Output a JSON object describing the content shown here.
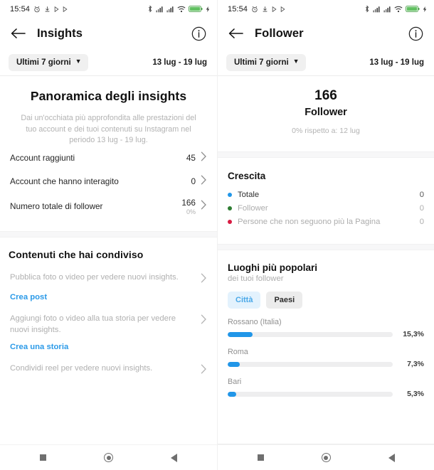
{
  "status_bar": {
    "time": "15:54",
    "left_icons": [
      "alarm-icon",
      "download-icon",
      "play-icon",
      "play-icon"
    ],
    "right_icons": [
      "bluetooth-icon",
      "signal-icon",
      "signal-icon",
      "wifi-icon",
      "battery-icon",
      "charging-icon"
    ],
    "battery_level": "99"
  },
  "colors": {
    "accent_blue": "#2196e8",
    "link_blue": "#2b9ae8",
    "chip_active_bg": "#e3f2fd",
    "chip_inactive_bg": "#ececec",
    "growth_total": "#2196e8",
    "growth_follower": "#2e7d32",
    "growth_unfollow": "#d81b42",
    "track_gray": "#eeeeef"
  },
  "left": {
    "appbar": {
      "title": "Insights",
      "back_icon": "arrow-left-icon",
      "info_icon": "info-circle-icon"
    },
    "filter": {
      "range_label": "Ultimi 7 giorni",
      "caret_icon": "chevron-down-icon",
      "date_range": "13 lug - 19 lug"
    },
    "overview": {
      "title": "Panoramica degli insights",
      "description": "Dai un'occhiata più approfondita alle prestazioni del tuo account e dei tuoi contenuti su Instagram nel periodo 13 lug - 19 lug."
    },
    "metrics": [
      {
        "label": "Account raggiunti",
        "value": "45",
        "sub": ""
      },
      {
        "label": "Account che hanno interagito",
        "value": "0",
        "sub": ""
      },
      {
        "label": "Numero totale di follower",
        "value": "166",
        "sub": "0%"
      }
    ],
    "content_section": {
      "title": "Contenuti che hai condiviso",
      "items": [
        {
          "text": "Pubblica foto o video per vedere nuovi insights.",
          "cta": "Crea post"
        },
        {
          "text": "Aggiungi foto o video alla tua storia per vedere nuovi insights.",
          "cta": "Crea una storia"
        },
        {
          "text": "Condividi reel per vedere nuovi insights.",
          "cta": ""
        }
      ]
    }
  },
  "right": {
    "appbar": {
      "title": "Follower",
      "back_icon": "arrow-left-icon",
      "info_icon": "info-circle-icon"
    },
    "filter": {
      "range_label": "Ultimi 7 giorni",
      "caret_icon": "chevron-down-icon",
      "date_range": "13 lug - 19 lug"
    },
    "kpi": {
      "number": "166",
      "label": "Follower",
      "comparison": "0% rispetto a: 12 lug"
    },
    "growth": {
      "title": "Crescita",
      "items": [
        {
          "name": "Totale",
          "value": "0",
          "color": "#2196e8"
        },
        {
          "name": "Follower",
          "value": "0",
          "color": "#2e7d32"
        },
        {
          "name": "Persone che non seguono più la Pagina",
          "value": "0",
          "color": "#d81b42"
        }
      ]
    },
    "places": {
      "title": "Luoghi più popolari",
      "subtitle": "dei tuoi follower",
      "tabs": [
        {
          "label": "Città",
          "active": true
        },
        {
          "label": "Paesi",
          "active": false
        }
      ]
    }
  },
  "chart_data": {
    "type": "bar",
    "title": "Luoghi più popolari",
    "subtitle": "dei tuoi follower",
    "orientation": "horizontal",
    "categories": [
      "Rossano (Italia)",
      "Roma",
      "Bari"
    ],
    "values": [
      15.3,
      7.3,
      5.3
    ],
    "value_labels": [
      "15,3%",
      "7,3%",
      "5,3%"
    ],
    "xlabel": "",
    "ylabel": "",
    "xlim": [
      0,
      100
    ],
    "unit": "%",
    "grid": false,
    "legend": false,
    "series_color": "#2196e8",
    "track_color": "#eeeeef"
  },
  "navbar": {
    "buttons": [
      {
        "icon": "recents-square-icon"
      },
      {
        "icon": "home-circle-icon"
      },
      {
        "icon": "back-triangle-icon"
      }
    ]
  }
}
